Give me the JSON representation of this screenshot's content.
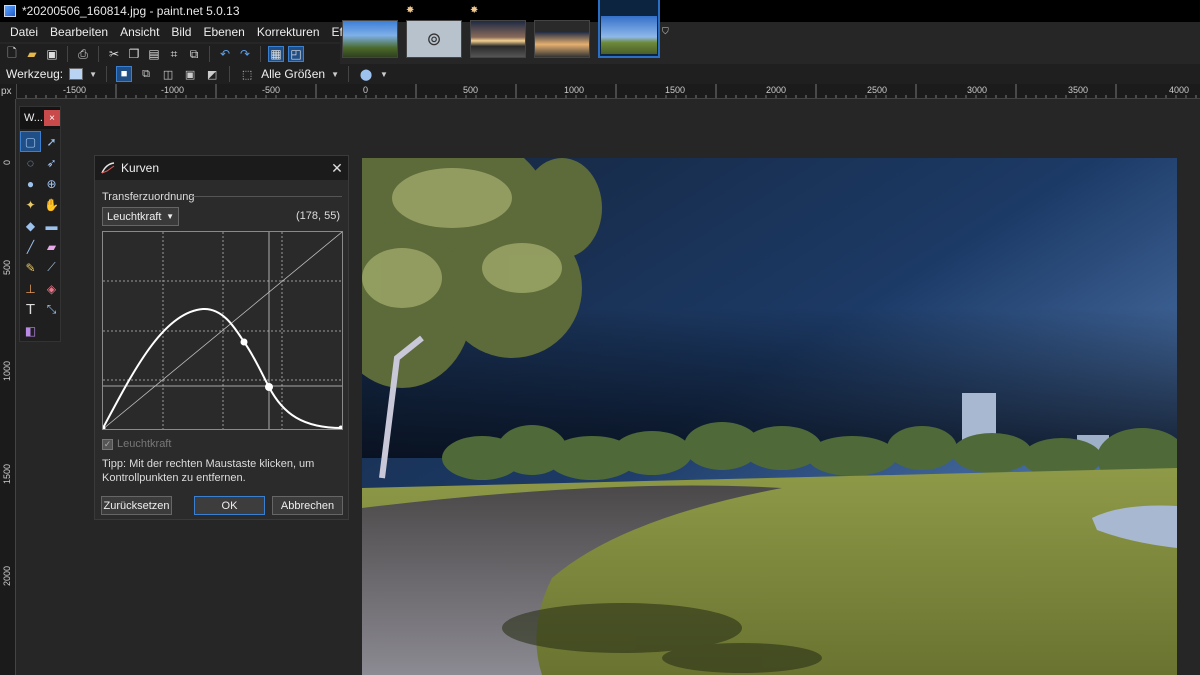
{
  "window": {
    "title": "*20200506_160814.jpg - paint.net 5.0.13"
  },
  "menu": {
    "items": [
      "Datei",
      "Bearbeiten",
      "Ansicht",
      "Bild",
      "Ebenen",
      "Korrekturen",
      "Effekte"
    ]
  },
  "options_bar": {
    "tool_label": "Werkzeug:",
    "sampling_label": "Alle Größen"
  },
  "ruler": {
    "unit": "px",
    "h_ticks": [
      "-1500",
      "-1000",
      "-500",
      "0",
      "500",
      "1000",
      "1500",
      "2000",
      "2500",
      "3000",
      "3500",
      "4000"
    ],
    "v_ticks": [
      "0",
      "500",
      "1000",
      "1500",
      "2000"
    ]
  },
  "tools_window": {
    "title": "W...",
    "close": "×"
  },
  "dialog": {
    "title": "Kurven",
    "close": "✕",
    "group_label": "Transferzuordnung",
    "mode_value": "Leuchtkraft",
    "coordinates": "(178, 55)",
    "checkbox_label": "Leuchtkraft",
    "checkbox_checked": true,
    "tip": "Tipp: Mit der rechten Maustaste klicken, um Kontrollpunkten zu entfernen.",
    "reset_button": "Zurücksetzen",
    "ok_button": "OK",
    "cancel_button": "Abbrechen"
  },
  "colors": {
    "accent": "#2b6fc4",
    "background": "#262626",
    "close_red": "#c94a4a"
  }
}
